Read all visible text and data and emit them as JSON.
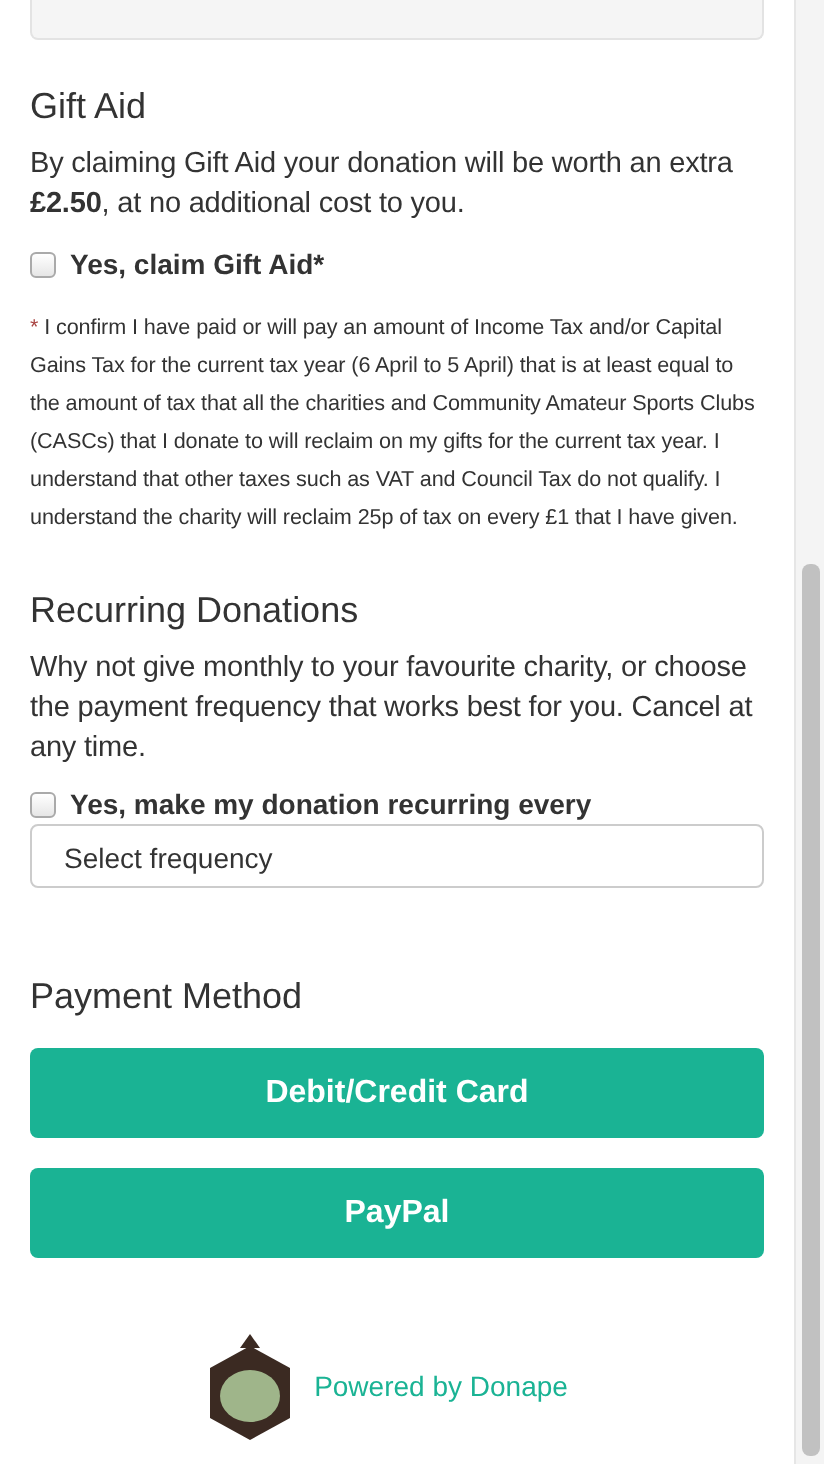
{
  "gift_aid": {
    "heading": "Gift Aid",
    "intro": "By claiming Gift Aid your donation will be worth an extra **£2.50**, at no additional cost to you.",
    "checkbox": {
      "label": "Yes, claim Gift Aid*",
      "checked": false
    },
    "declaration_mark": "*",
    "declaration": "I confirm I have paid or will pay an amount of Income Tax and/or Capital Gains Tax for the current tax year (6 April to 5 April) that is at least equal to the amount of tax that all the charities and Community Amateur Sports Clubs (CASCs) that I donate to will reclaim on my gifts for the current tax year. I understand that other taxes such as VAT and Council Tax do not qualify. I understand the charity will reclaim 25p of tax on every £1 that I have given."
  },
  "recurring": {
    "heading": "Recurring Donations",
    "intro": "Why not give monthly to your favourite charity, or choose the payment frequency that works best for you. Cancel at any time.",
    "checkbox": {
      "label": "Yes, make my donation recurring every",
      "checked": false
    },
    "frequency": {
      "value": "Select frequency"
    }
  },
  "payment": {
    "heading": "Payment Method",
    "buttons": [
      "Debit/Credit Card",
      "PayPal"
    ]
  },
  "footer": {
    "text": "Powered by Donape"
  }
}
